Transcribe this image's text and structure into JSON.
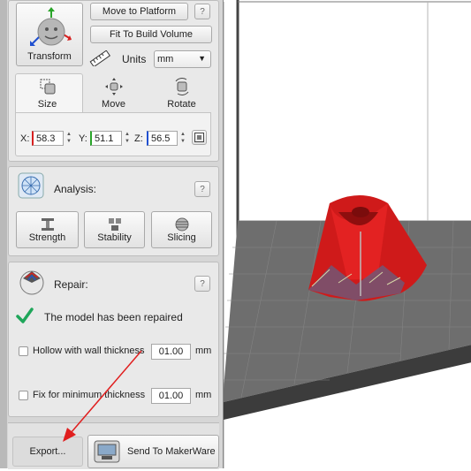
{
  "transform": {
    "transform_label": "Transform",
    "move_to_platform": "Move to Platform",
    "fit_to_build_volume": "Fit To Build Volume",
    "help": "?",
    "units_label": "Units",
    "units_value": "mm",
    "tabs": [
      {
        "label": "Size",
        "icon": "size-icon"
      },
      {
        "label": "Move",
        "icon": "move-icon"
      },
      {
        "label": "Rotate",
        "icon": "rotate-icon"
      }
    ],
    "x_label": "X:",
    "x_value": "58.3",
    "y_label": "Y:",
    "y_value": "51.1",
    "z_label": "Z:",
    "z_value": "56.5",
    "colors": {
      "x": "#d62020",
      "y": "#2aa52a",
      "z": "#2050d0"
    }
  },
  "analysis": {
    "title": "Analysis:",
    "help": "?",
    "buttons": [
      {
        "label": "Strength",
        "icon": "strength-icon"
      },
      {
        "label": "Stability",
        "icon": "stability-icon"
      },
      {
        "label": "Slicing",
        "icon": "slicing-icon"
      }
    ]
  },
  "repair": {
    "title": "Repair:",
    "help": "?",
    "status": "The model has been repaired",
    "hollow_label": "Hollow with wall thickness",
    "hollow_value": "01.00",
    "hollow_unit": "mm",
    "fix_label": "Fix for minimum thickness",
    "fix_value": "01.00",
    "fix_unit": "mm"
  },
  "footer": {
    "export": "Export...",
    "send": "Send To MakerWare"
  },
  "viewport": {
    "model_color": "#e01e1e",
    "platform_color": "#6b6b6b",
    "annotation_color": "#e01e1e"
  }
}
